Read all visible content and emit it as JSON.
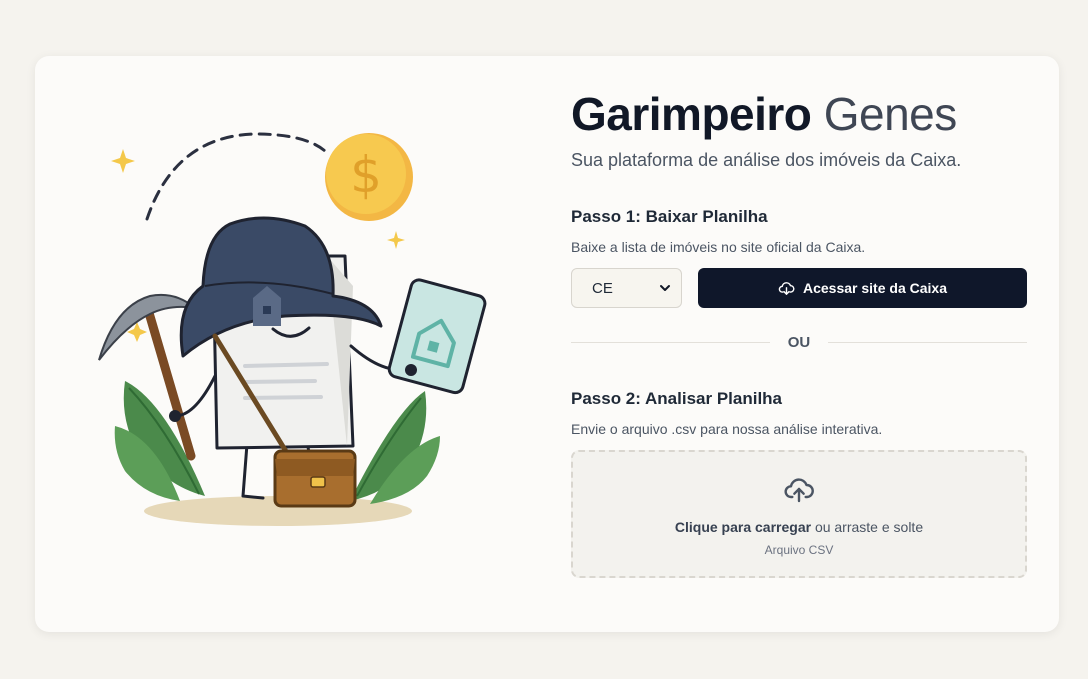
{
  "header": {
    "title_main": "Garimpeiro",
    "title_accent": "Genes",
    "subtitle": "Sua plataforma de análise dos imóveis da Caixa."
  },
  "step1": {
    "title": "Passo 1: Baixar Planilha",
    "description": "Baixe a lista de imóveis no site oficial da Caixa.",
    "state_select_value": "CE",
    "button_label": "Acessar site da Caixa"
  },
  "divider": {
    "label": "OU"
  },
  "step2": {
    "title": "Passo 2: Analisar Planilha",
    "description": "Envie o arquivo .csv para nossa análise interativa.",
    "upload_bold": "Clique para carregar",
    "upload_rest": "ou arraste e solte",
    "upload_hint": "Arquivo CSV"
  },
  "icons": {
    "button": "cloud-download-icon",
    "dropzone": "cloud-upload-icon",
    "select": "chevron-down-icon"
  },
  "colors": {
    "background": "#f5f3ee",
    "card": "#fcfbf9",
    "primary_button": "#0f172a",
    "title": "#111827",
    "title_accent": "#3f4654"
  }
}
